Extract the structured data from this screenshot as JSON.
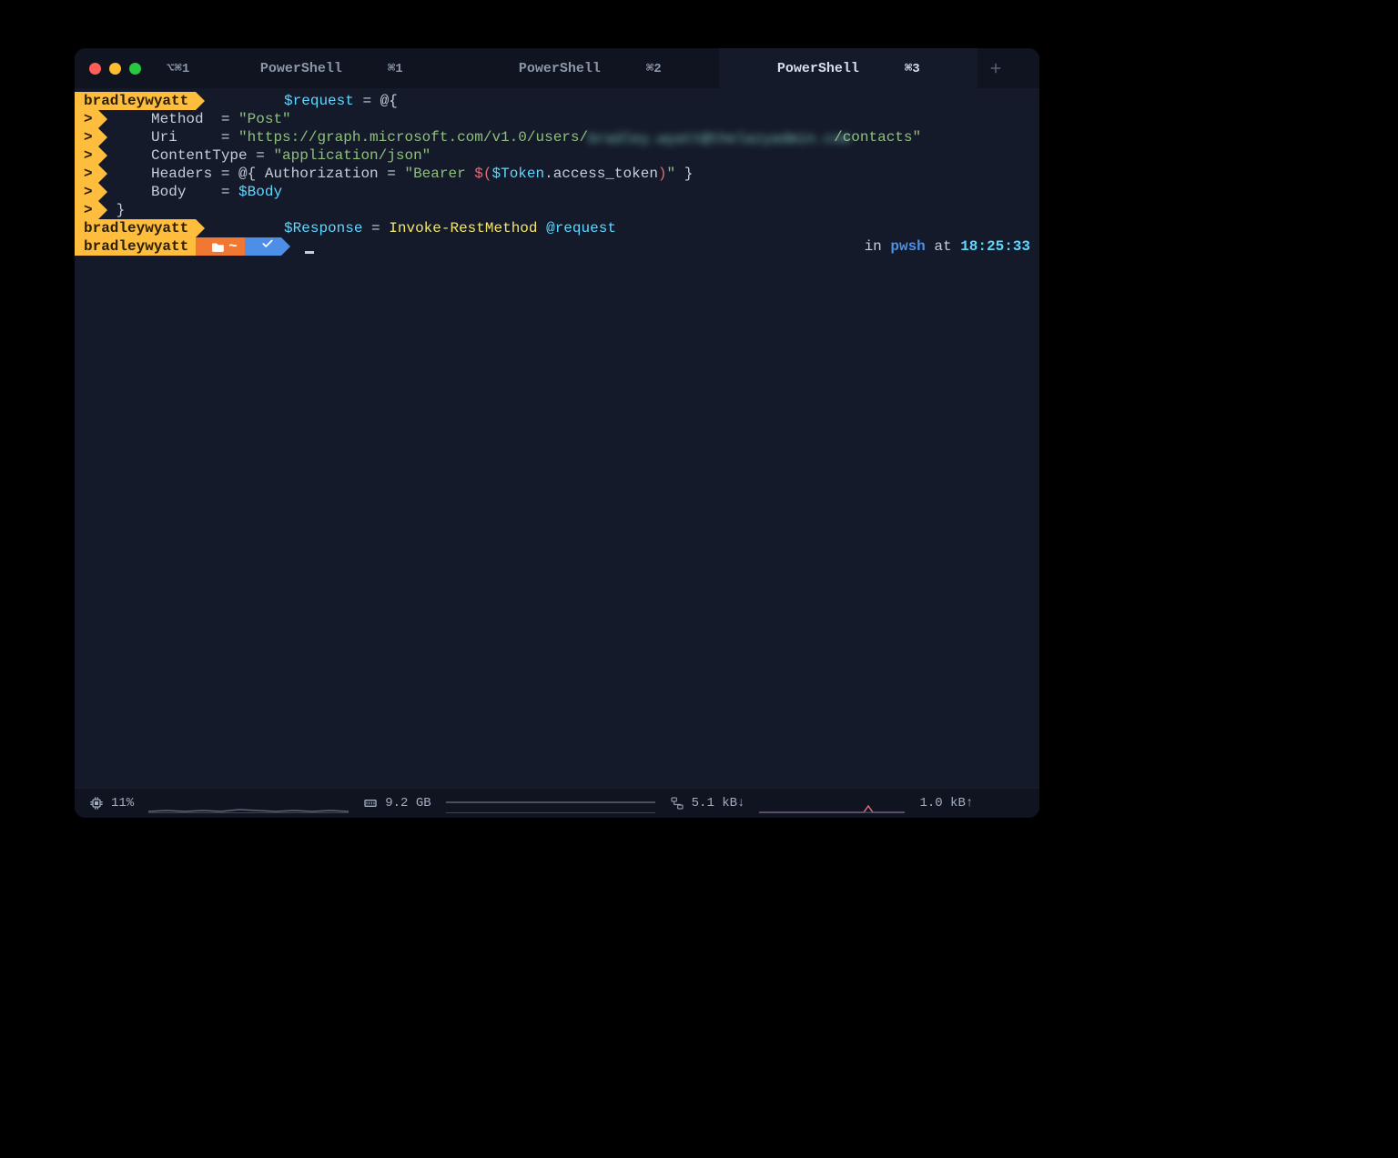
{
  "tabs": {
    "first_shortcut": "⌥⌘1",
    "tab1_label": "PowerShell",
    "tab1_shortcut": "⌘1",
    "tab2_label": "PowerShell",
    "tab2_shortcut": "⌘2",
    "tab3_label": "PowerShell",
    "tab3_shortcut": "⌘3"
  },
  "prompt": {
    "user": "bradleywyatt",
    "cont": ">",
    "home": "~"
  },
  "lines": {
    "l1_var": "$request",
    "l1_rest": " = @{",
    "l2": "    Method  = ",
    "l2_str": "\"Post\"",
    "l3": "    Uri     = ",
    "l3_str1": "\"https://graph.microsoft.com/v1.0/users/",
    "l3_redacted": "bradley.wyatt@thelazyadmin.com",
    "l3_str2": "/contacts\"",
    "l4": "    ContentType = ",
    "l4_str": "\"application/json\"",
    "l5a": "    Headers = @{ Authorization = ",
    "l5_str1": "\"Bearer ",
    "l5_sub1": "$(",
    "l5_tok": "$Token",
    "l5_sub2": ".access_token",
    "l5_sub3": ")",
    "l5_str2": "\"",
    "l5b": " }",
    "l6": "    Body    = ",
    "l6_var": "$Body",
    "l7": "}",
    "l8_var": "$Response",
    "l8_op": " = ",
    "l8_cmd": "Invoke-RestMethod",
    "l8_arg": " @request"
  },
  "right_status": {
    "in": "in ",
    "shell": "pwsh",
    "at": " at ",
    "time": "18:25:33"
  },
  "statusbar": {
    "cpu": "11%",
    "mem": "9.2 GB",
    "net_down": "5.1 kB↓",
    "net_up": "1.0 kB↑"
  }
}
